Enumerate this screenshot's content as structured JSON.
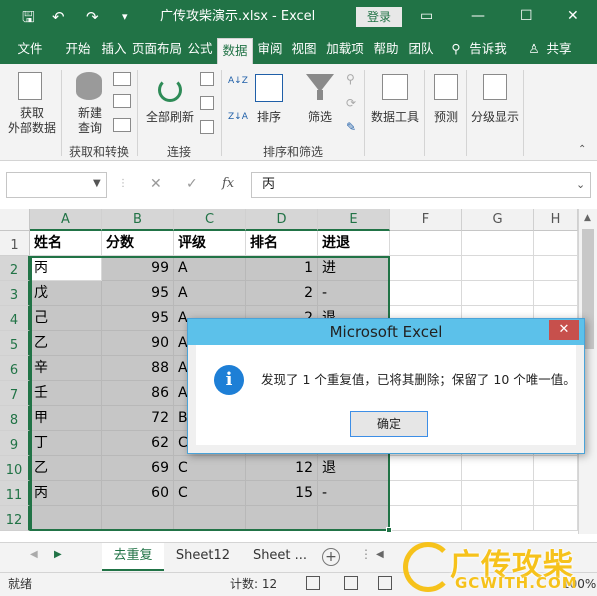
{
  "window": {
    "title": "广传攻柴演示.xlsx  -  Excel",
    "login": "登录",
    "qa_save": "🖫",
    "qa_undo": "↶",
    "qa_redo": "↷",
    "qa_more": "▾"
  },
  "ribbon_tabs": [
    "文件",
    "开始",
    "插入",
    "页面布局",
    "公式",
    "数据",
    "审阅",
    "视图",
    "加载项",
    "帮助",
    "团队",
    "告诉我",
    "共享"
  ],
  "active_tab": "数据",
  "ribbon": {
    "get_external": "获取\n外部数据",
    "new_query": "新建\n查询",
    "refresh_all": "全部刷新",
    "sort": "排序",
    "filter": "筛选",
    "data_tools": "数据工具",
    "forecast": "预测",
    "outline": "分级显示",
    "group_get_transform": "获取和转换",
    "group_connections": "连接",
    "group_sort_filter": "排序和筛选",
    "sort_az": "A↓Z",
    "sort_za": "Z↓A"
  },
  "formula_bar": {
    "name_box": "",
    "fx": "fx",
    "cancel": "✕",
    "enter": "✓",
    "value": "丙"
  },
  "columns": [
    "A",
    "B",
    "C",
    "D",
    "E",
    "F",
    "G",
    "H"
  ],
  "rows": [
    "1",
    "2",
    "3",
    "4",
    "5",
    "6",
    "7",
    "8",
    "9",
    "10",
    "11",
    "12"
  ],
  "table": {
    "headers": [
      "姓名",
      "分数",
      "评级",
      "排名",
      "进退"
    ],
    "data": [
      [
        "丙",
        "99",
        "A",
        "1",
        "进"
      ],
      [
        "戊",
        "95",
        "A",
        "2",
        "-"
      ],
      [
        "己",
        "95",
        "A",
        "2",
        "退"
      ],
      [
        "乙",
        "90",
        "A",
        "",
        ""
      ],
      [
        "辛",
        "88",
        "A",
        "",
        ""
      ],
      [
        "壬",
        "86",
        "A",
        "",
        ""
      ],
      [
        "甲",
        "72",
        "B",
        "",
        ""
      ],
      [
        "丁",
        "62",
        "C",
        "",
        ""
      ],
      [
        "乙",
        "69",
        "C",
        "12",
        "退"
      ],
      [
        "丙",
        "60",
        "C",
        "15",
        "-"
      ]
    ]
  },
  "dialog": {
    "title": "Microsoft Excel",
    "message": "发现了 1 个重复值，已将其删除；保留了 10 个唯一值。",
    "ok": "确定",
    "close": "✕",
    "info_glyph": "i"
  },
  "sheets": [
    "去重复",
    "Sheet12",
    "Sheet ..."
  ],
  "active_sheet": "去重复",
  "status": {
    "ready": "就绪",
    "count": "计数: 12",
    "zoom": "100%"
  },
  "watermark": {
    "text": "广传攻柴",
    "url": "GCWITH.COM"
  }
}
